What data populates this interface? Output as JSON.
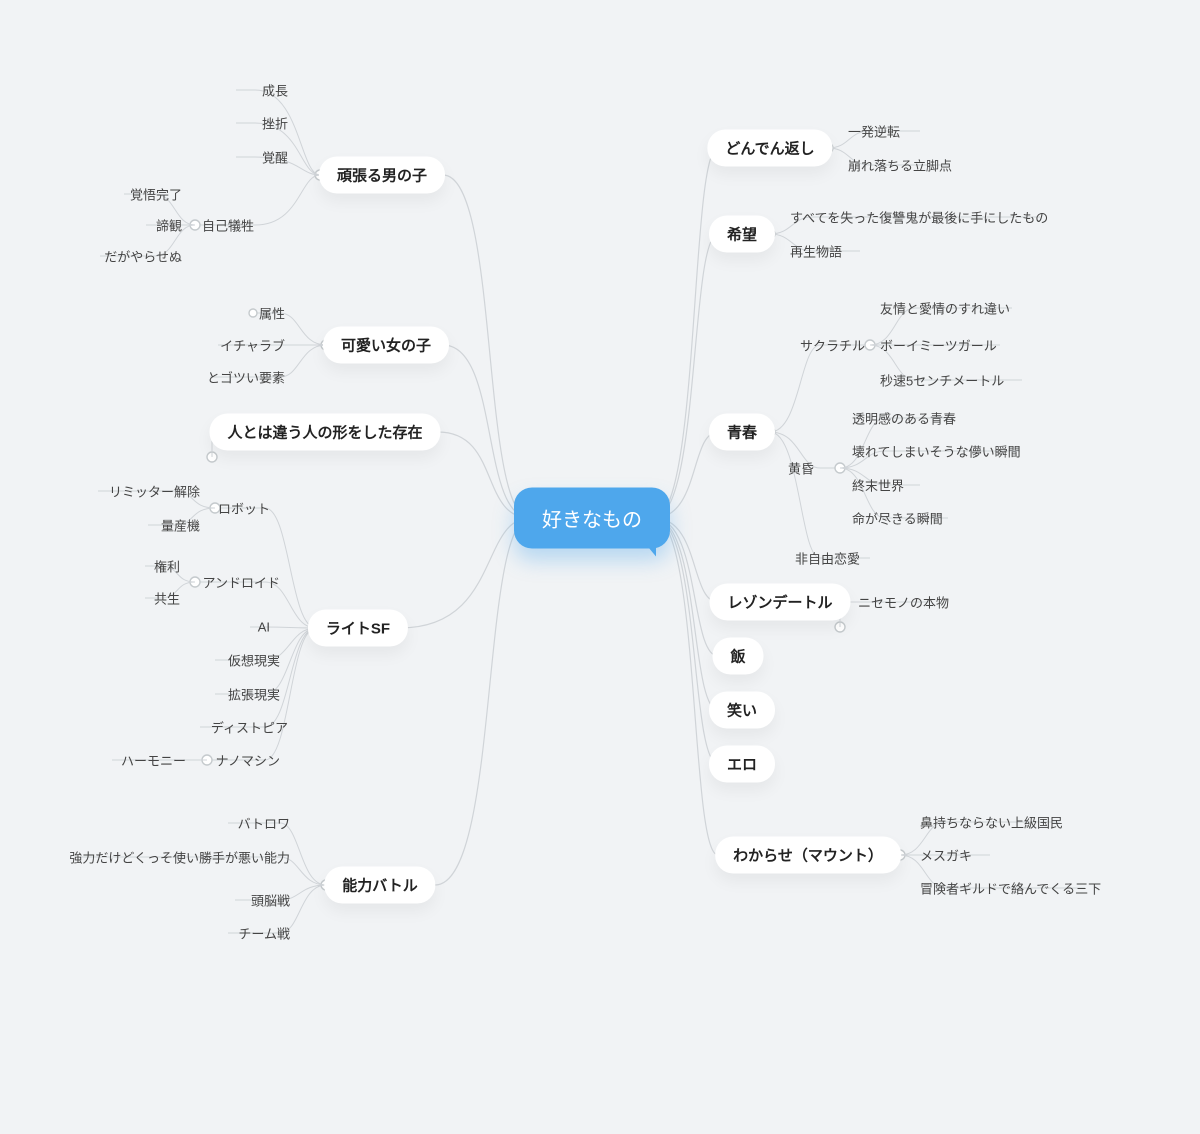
{
  "root": {
    "label": "好きなもの"
  },
  "left": [
    {
      "label": "頑張る男の子",
      "children": [
        {
          "label": "成長"
        },
        {
          "label": "挫折"
        },
        {
          "label": "覚醒"
        },
        {
          "label": "自己犠牲",
          "children": [
            {
              "label": "覚悟完了"
            },
            {
              "label": "諦観"
            },
            {
              "label": "だがやらせぬ"
            }
          ]
        }
      ]
    },
    {
      "label": "可愛い女の子",
      "children": [
        {
          "label": "属性"
        },
        {
          "label": "イチャラブ"
        },
        {
          "label": "とゴツい要素"
        }
      ]
    },
    {
      "label": "人とは違う人の形をした存在"
    },
    {
      "label": "ライトSF",
      "children": [
        {
          "label": "ロボット",
          "children": [
            {
              "label": "リミッター解除"
            },
            {
              "label": "量産機"
            }
          ]
        },
        {
          "label": "アンドロイド",
          "children": [
            {
              "label": "権利"
            },
            {
              "label": "共生"
            }
          ]
        },
        {
          "label": "AI"
        },
        {
          "label": "仮想現実"
        },
        {
          "label": "拡張現実"
        },
        {
          "label": "ディストピア"
        },
        {
          "label": "ナノマシン",
          "children": [
            {
              "label": "ハーモニー"
            }
          ]
        }
      ]
    },
    {
      "label": "能力バトル",
      "children": [
        {
          "label": "バトロワ"
        },
        {
          "label": "強力だけどくっそ使い勝手が悪い能力"
        },
        {
          "label": "頭脳戦"
        },
        {
          "label": "チーム戦"
        }
      ]
    }
  ],
  "right": [
    {
      "label": "どんでん返し",
      "children": [
        {
          "label": "一発逆転"
        },
        {
          "label": "崩れ落ちる立脚点"
        }
      ]
    },
    {
      "label": "希望",
      "children": [
        {
          "label": "すべてを失った復讐鬼が最後に手にしたもの"
        },
        {
          "label": "再生物語"
        }
      ]
    },
    {
      "label": "青春",
      "children": [
        {
          "label": "サクラチル",
          "children": [
            {
              "label": "友情と愛情のすれ違い"
            },
            {
              "label": "ボーイミーツガール"
            },
            {
              "label": "秒速5センチメートル"
            }
          ]
        },
        {
          "label": "黄昏",
          "children": [
            {
              "label": "透明感のある青春"
            },
            {
              "label": "壊れてしまいそうな儚い瞬間"
            },
            {
              "label": "終末世界"
            },
            {
              "label": "命が尽きる瞬間"
            }
          ]
        },
        {
          "label": "非自由恋愛"
        }
      ]
    },
    {
      "label": "レゾンデートル",
      "children": [
        {
          "label": "ニセモノの本物"
        }
      ]
    },
    {
      "label": "飯"
    },
    {
      "label": "笑い"
    },
    {
      "label": "エロ"
    },
    {
      "label": "わからせ（マウント）",
      "children": [
        {
          "label": "鼻持ちならない上級国民"
        },
        {
          "label": "メスガキ"
        },
        {
          "label": "冒険者ギルドで絡んでくる三下"
        }
      ]
    }
  ]
}
